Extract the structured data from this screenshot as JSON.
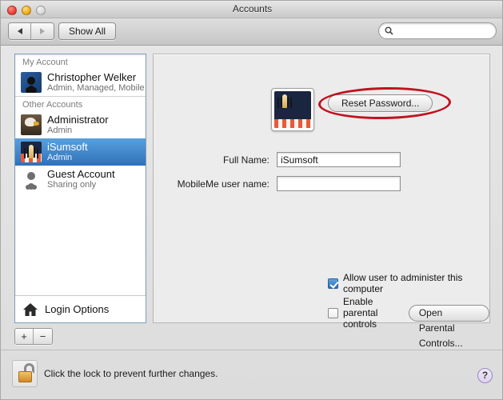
{
  "window": {
    "title": "Accounts",
    "controls": {
      "close": "close-button",
      "minimize": "minimize-button",
      "zoom": "zoom-button"
    }
  },
  "toolbar": {
    "back_label": "◀",
    "forward_label": "▶",
    "show_all_label": "Show All",
    "search": {
      "value": "",
      "placeholder": ""
    }
  },
  "sidebar": {
    "groups": [
      {
        "header": "My Account",
        "accounts": [
          {
            "name": "Christopher Welker",
            "role": "Admin, Managed, Mobile",
            "avatar": "av-blue",
            "selected": false
          }
        ]
      },
      {
        "header": "Other Accounts",
        "accounts": [
          {
            "name": "Administrator",
            "role": "Admin",
            "avatar": "av-eagle",
            "selected": false
          },
          {
            "name": "iSumsoft",
            "role": "Admin",
            "avatar": "av-chess",
            "selected": true
          },
          {
            "name": "Guest Account",
            "role": "Sharing only",
            "avatar": "av-guest",
            "selected": false
          }
        ]
      }
    ],
    "login_options_label": "Login Options",
    "add_label": "+",
    "remove_label": "−"
  },
  "main": {
    "reset_password_label": "Reset Password...",
    "fields": [
      {
        "label": "Full Name:",
        "value": "iSumsoft",
        "placeholder": ""
      },
      {
        "label": "MobileMe user name:",
        "value": "",
        "placeholder": ""
      }
    ],
    "checkboxes": [
      {
        "label": "Allow user to administer this computer",
        "checked": true
      },
      {
        "label": "Enable parental controls",
        "checked": false
      }
    ],
    "parental_button_label": "Open Parental Controls..."
  },
  "footer": {
    "lock_text": "Click the lock to prevent further changes.",
    "help_label": "?"
  },
  "colors": {
    "selection_blue": "#2f71b8",
    "annotation_red": "#c1121f",
    "lock_gold": "#d08b25"
  }
}
